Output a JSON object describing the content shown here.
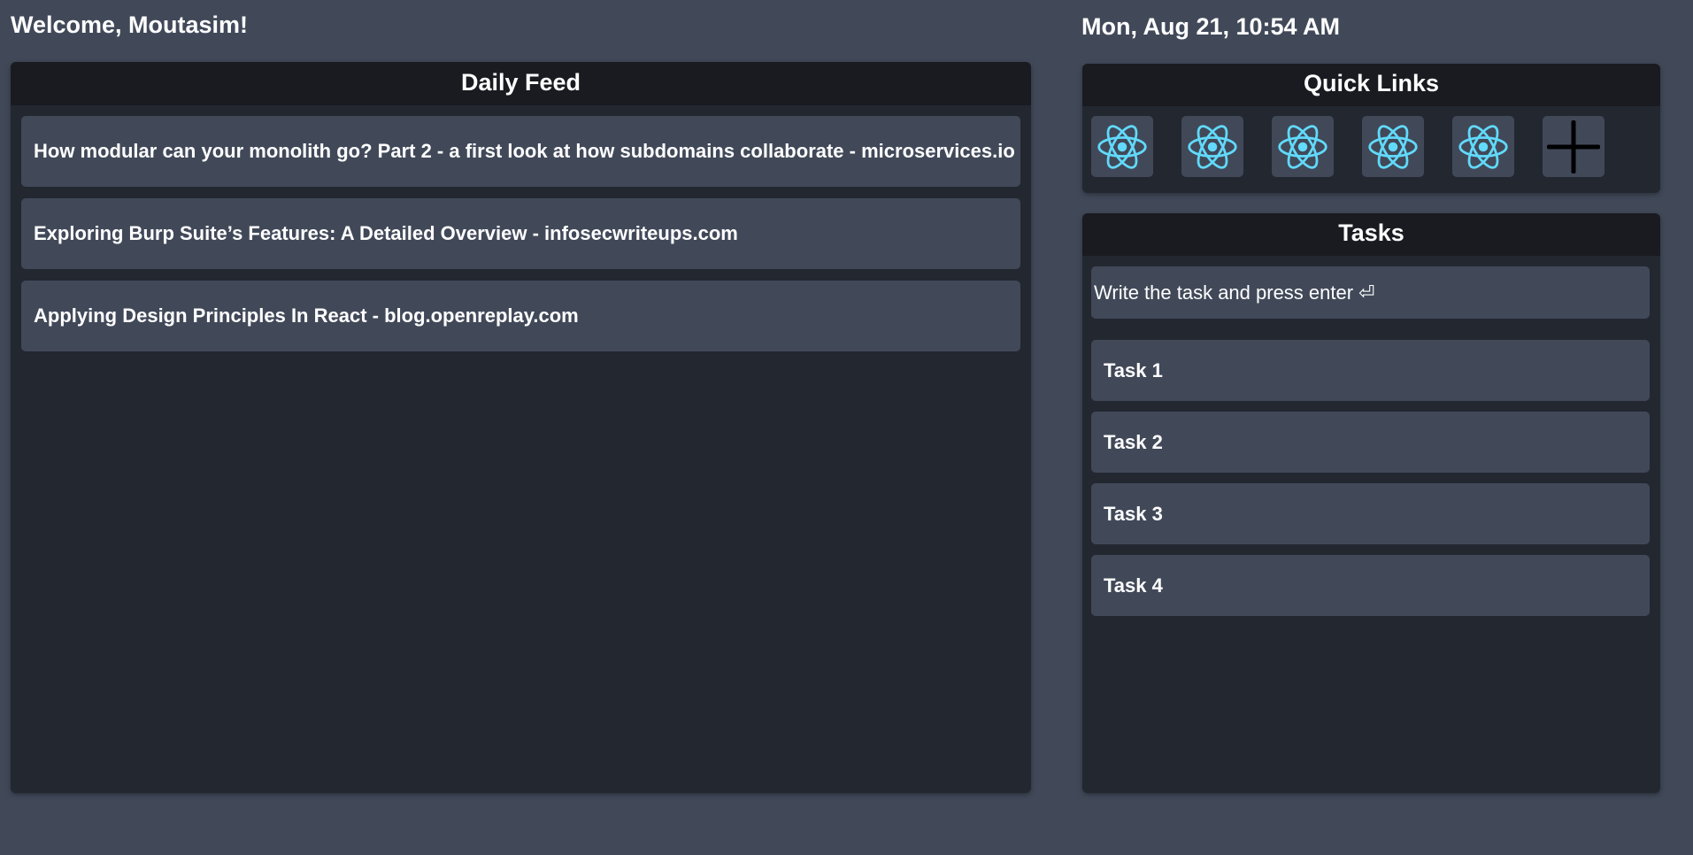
{
  "header": {
    "welcome": "Welcome, Moutasim!",
    "datetime": "Mon, Aug 21, 10:54 AM"
  },
  "daily_feed": {
    "title": "Daily Feed",
    "items": [
      "How modular can your monolith go? Part 2 - a first look at how subdomains collaborate - microservices.io",
      "Exploring Burp Suite’s Features: A Detailed Overview - infosecwriteups.com",
      "Applying Design Principles In React - blog.openreplay.com"
    ]
  },
  "quick_links": {
    "title": "Quick Links",
    "links": [
      {
        "icon": "react-icon"
      },
      {
        "icon": "react-icon"
      },
      {
        "icon": "react-icon"
      },
      {
        "icon": "react-icon"
      },
      {
        "icon": "react-icon"
      }
    ],
    "add_icon": "plus-icon"
  },
  "tasks": {
    "title": "Tasks",
    "placeholder": "Write the task and press enter ⏎",
    "items": [
      "Task 1",
      "Task 2",
      "Task 3",
      "Task 4"
    ]
  },
  "colors": {
    "background": "#414959",
    "panel": "#232730",
    "panel_header": "#191b20",
    "react_blue": "#61dafb"
  }
}
